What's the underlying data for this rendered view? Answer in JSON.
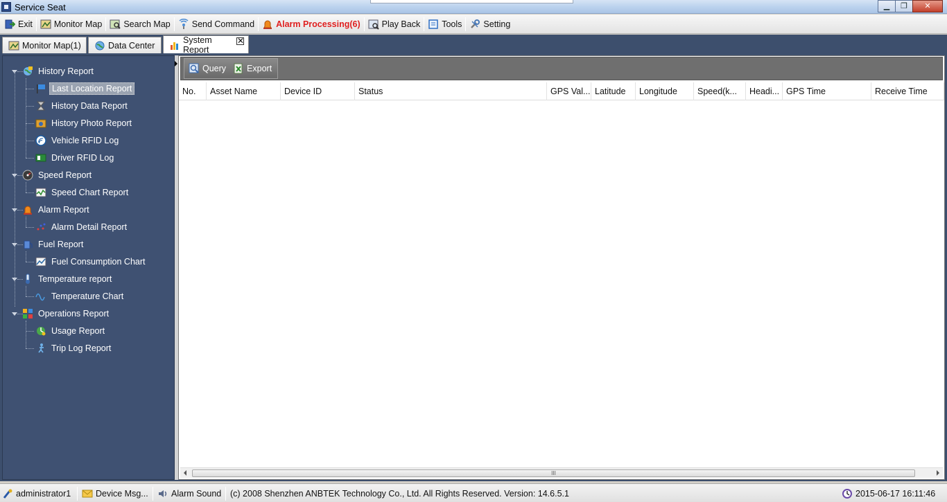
{
  "window": {
    "title": "Service Seat",
    "controls": {
      "minimize": "▁",
      "maximize": "❐",
      "close": "✕"
    }
  },
  "toolbar": {
    "items": [
      {
        "label": "Exit",
        "icon": "exit-icon"
      },
      {
        "label": "Monitor Map",
        "icon": "monitor-map-icon"
      },
      {
        "label": "Search Map",
        "icon": "search-map-icon"
      },
      {
        "label": "Send Command",
        "icon": "send-command-icon"
      },
      {
        "label": "Alarm Processing(6)",
        "icon": "alarm-bell-icon"
      },
      {
        "label": "Play Back",
        "icon": "play-back-icon"
      },
      {
        "label": "Tools",
        "icon": "tools-icon"
      },
      {
        "label": "Setting",
        "icon": "setting-icon"
      }
    ]
  },
  "tabs": [
    {
      "label": "Monitor Map(1)",
      "icon": "map-icon"
    },
    {
      "label": "Data Center",
      "icon": "globe-icon"
    },
    {
      "label": "System Report",
      "icon": "bar-chart-icon",
      "close": "✕"
    }
  ],
  "sidebar": {
    "groups": [
      {
        "label": "History Report",
        "icon": "history-report-icon",
        "children": [
          {
            "label": "Last Location Report",
            "icon": "flag-icon",
            "selected": true
          },
          {
            "label": "History Data Report",
            "icon": "hourglass-icon"
          },
          {
            "label": "History Photo Report",
            "icon": "photo-icon"
          },
          {
            "label": "Vehicle RFID Log",
            "icon": "rfid-icon"
          },
          {
            "label": "Driver RFID Log",
            "icon": "driver-card-icon"
          }
        ]
      },
      {
        "label": "Speed Report",
        "icon": "speedometer-icon",
        "children": [
          {
            "label": "Speed Chart Report",
            "icon": "line-chart-icon"
          }
        ]
      },
      {
        "label": "Alarm Report",
        "icon": "alarm-light-icon",
        "children": [
          {
            "label": "Alarm Detail Report",
            "icon": "scatter-icon"
          }
        ]
      },
      {
        "label": "Fuel Report",
        "icon": "fuel-icon",
        "children": [
          {
            "label": "Fuel Consumption Chart",
            "icon": "fuel-chart-icon"
          }
        ]
      },
      {
        "label": "Temperature report",
        "icon": "thermometer-icon",
        "children": [
          {
            "label": "Temperature Chart",
            "icon": "wave-icon"
          }
        ]
      },
      {
        "label": "Operations Report",
        "icon": "operations-icon",
        "children": [
          {
            "label": "Usage Report",
            "icon": "usage-icon"
          },
          {
            "label": "Trip Log Report",
            "icon": "trip-icon"
          }
        ]
      }
    ]
  },
  "report": {
    "actions": {
      "query": "Query",
      "export": "Export"
    },
    "columns": [
      "No.",
      "Asset Name",
      "Device ID",
      "Status",
      "GPS Val...",
      "Latitude",
      "Longitude",
      "Speed(k...",
      "Headi...",
      "GPS Time",
      "Receive Time"
    ],
    "rows": [],
    "scroll_grip": "III"
  },
  "statusbar": {
    "user": "administrator1",
    "device_msg": "Device Msg...",
    "alarm_sound": "Alarm Sound",
    "copyright": "(c) 2008 Shenzhen ANBTEK Technology Co., Ltd. All Rights Reserved. Version: 14.6.5.1",
    "datetime": "2015-06-17 16:11:46"
  },
  "colors": {
    "sidebar_bg": "#3f5172",
    "frame_bg": "#3d4f6d",
    "alarm_text": "#e02020",
    "query_bar": "#6f6f6f"
  }
}
